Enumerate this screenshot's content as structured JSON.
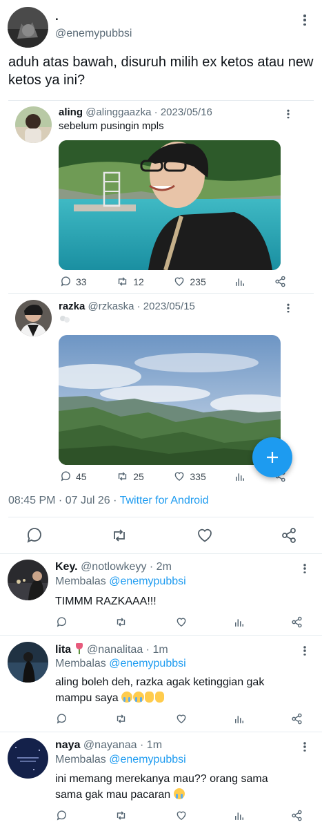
{
  "tweet": {
    "display_name": ".",
    "handle": "@enemypubbsi",
    "text": "aduh atas bawah, disuruh milih ex ketos atau new ketos ya ini?",
    "time": "08:45 PM · 07 Jul 26 · ",
    "client": "Twitter for Android"
  },
  "quotes": [
    {
      "name": "aling",
      "handle": "@alinggaazka",
      "date": "· 2023/05/16",
      "text": "sebelum pusingin mpls",
      "replies": "33",
      "retweets": "12",
      "likes": "235"
    },
    {
      "name": "razka",
      "handle": "@rzkaska",
      "date": "· 2023/05/15",
      "text": "",
      "replies": "45",
      "retweets": "25",
      "likes": "335"
    }
  ],
  "replies": [
    {
      "name": "Key.",
      "handle": "@notlowkeyy",
      "time": "· 2m",
      "replying_prefix": "Membalas",
      "replying_to": "@enemypubbsi",
      "text": "TIMMM RAZKAAA!!!"
    },
    {
      "name": "lita",
      "emoji": "tulip",
      "handle": "@nanalitaa",
      "time": "· 1m",
      "replying_prefix": "Membalas",
      "replying_to": "@enemypubbsi",
      "text": "aling boleh deh, razka agak ketinggian gak mampu saya"
    },
    {
      "name": "naya",
      "handle": "@nayanaa",
      "time": "· 1m",
      "replying_prefix": "Membalas",
      "replying_to": "@enemypubbsi",
      "text": "ini memang merekanya mau?? orang sama sama gak mau pacaran"
    }
  ],
  "fab": {
    "icon": "plus-icon",
    "color": "#1d9bf0"
  },
  "colors": {
    "accent": "#1d9bf0",
    "text": "#0f1419",
    "muted": "#5b6b77"
  }
}
